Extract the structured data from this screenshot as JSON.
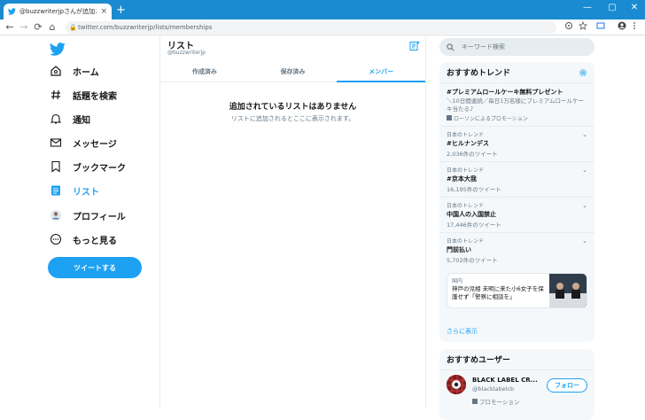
{
  "browser": {
    "tab_title": "@buzzwriterjpさんが追加されてい...",
    "tab_close": "×",
    "new_tab": "+",
    "url": "twitter.com/buzzwriterjp/lists/memberships",
    "win_min": "—",
    "win_max": "▢",
    "win_close": "✕",
    "back": "←",
    "forward": "→",
    "reload": "⟳",
    "home": "⌂",
    "lock": "🔒"
  },
  "sidebar": {
    "items": [
      {
        "label": "ホーム",
        "icon": "home-icon"
      },
      {
        "label": "話題を検索",
        "icon": "hashtag-icon"
      },
      {
        "label": "通知",
        "icon": "bell-icon"
      },
      {
        "label": "メッセージ",
        "icon": "mail-icon"
      },
      {
        "label": "ブックマーク",
        "icon": "bookmark-icon"
      },
      {
        "label": "リスト",
        "icon": "list-icon"
      },
      {
        "label": "プロフィール",
        "icon": "avatar-icon"
      },
      {
        "label": "もっと見る",
        "icon": "more-icon"
      }
    ],
    "tweet_button": "ツイートする",
    "accent": "#1da1f2"
  },
  "main": {
    "title": "リスト",
    "handle": "@buzzwriterjp",
    "tabs": [
      "作成済み",
      "保存済み",
      "メンバー"
    ],
    "active_tab": "メンバー",
    "empty_title": "追加されているリストはありません",
    "empty_sub": "リストに追加されるとここに表示されます。"
  },
  "right": {
    "search_placeholder": "キーワード検索",
    "trends_title": "おすすめトレンド",
    "trends": [
      {
        "name": "#プレミアムロールケーキ無料プレゼント",
        "desc": "＼10日間連続／毎日1万名様にプレミアムロールケーキ当たる♪",
        "promo": "ローソンによるプロモーション"
      },
      {
        "ctx": "日本のトレンド",
        "name": "#ヒルナンデス",
        "count": "2,036件のツイート"
      },
      {
        "ctx": "日本のトレンド",
        "name": "#京本大我",
        "count": "16,195件のツイート"
      },
      {
        "ctx": "日本のトレンド",
        "name": "中国人の入国禁止",
        "count": "17,446件のツイート"
      },
      {
        "ctx": "日本のトレンド",
        "name": "門前払い",
        "count": "5,702件のツイート"
      }
    ],
    "news": {
      "category": "国内",
      "headline": "神戸の児相 未明に来た小6女子を保護せず「警察に相談を」"
    },
    "more_link": "さらに表示",
    "users_title": "おすすめユーザー",
    "user": {
      "name": "BLACK LABEL CR...",
      "handle": "@blacklabelcb",
      "promo": "プロモーション",
      "follow": "フォロー"
    }
  }
}
